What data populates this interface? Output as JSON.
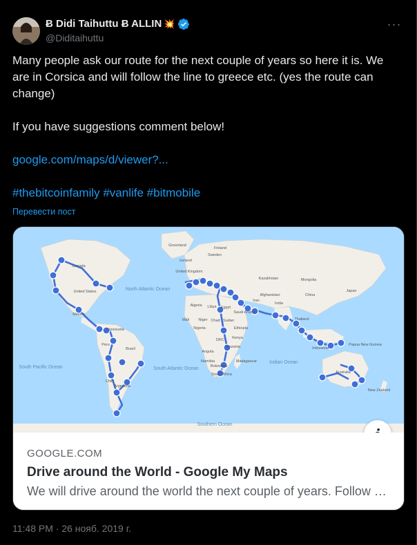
{
  "author": {
    "display_name": "Ƀ Didi Taihuttu Ƀ ALLIN",
    "spark_emoji": "💥",
    "handle": "@Diditaihuttu",
    "verified": true
  },
  "more_icon": "more-dots-icon",
  "tweet": {
    "line1": "Many people ask our route for the next couple of years so here it is. We are in Corsica and will follow the line to greece etc. (yes the route can change)",
    "line2": "If you have suggestions comment below!",
    "url": "google.com/maps/d/viewer?...",
    "hashtags": "#thebitcoinfamily #vanlife #bitmobile"
  },
  "translate_label": "Перевести пост",
  "card": {
    "domain": "GOOGLE.COM",
    "title": "Drive around the World - Google My Maps",
    "description": "We will drive around the world the next couple of years. Follow our route!",
    "info_icon": "i"
  },
  "map_labels": {
    "north_atlantic": "North Atlantic Ocean",
    "south_pacific": "South Pacific Ocean",
    "south_atlantic": "South Atlantic Ocean",
    "indian": "Indian Ocean",
    "southern": "Southern Ocean",
    "canada": "Canada",
    "united_states": "United States",
    "mexico": "Mexico",
    "venezuela": "Venezuela",
    "brazil": "Brazil",
    "peru": "Peru",
    "chile": "Chile",
    "argentina": "Argentina",
    "greenland": "Greenland",
    "iceland": "Iceland",
    "sweden": "Sweden",
    "finland": "Finland",
    "united_kingdom": "United Kingdom",
    "kazakhstan": "Kazakhstan",
    "mongolia": "Mongolia",
    "china": "China",
    "afghanistan": "Afghanistan",
    "iran": "Iran",
    "india": "India",
    "japan": "Japan",
    "algeria": "Algeria",
    "libya": "Libya",
    "egypt": "Egypt",
    "saudi_arabia": "Saudi Arabia",
    "mali": "Mali",
    "niger": "Niger",
    "chad": "Chad",
    "sudan": "Sudan",
    "nigeria": "Nigeria",
    "ethiopia": "Ethiopia",
    "drc": "DRC",
    "kenya": "Kenya",
    "tanzania": "Tanzania",
    "angola": "Angola",
    "namibia": "Namibia",
    "botswana": "Botswana",
    "south_africa": "South Africa",
    "madagascar": "Madagascar",
    "indonesia": "Indonesia",
    "papua_new_guinea": "Papua New Guinea",
    "australia": "Australia",
    "new_zealand": "New Zealand",
    "thailand": "Thailand"
  },
  "colors": {
    "background": "#000000",
    "text": "#e7e9ea",
    "muted": "#71767b",
    "link": "#1d9bf0",
    "route": "#3f6fd6",
    "ocean": "#aadaff",
    "land": "#f2efe9"
  },
  "timestamp": "11:48 PM · 26 нояб. 2019 г."
}
